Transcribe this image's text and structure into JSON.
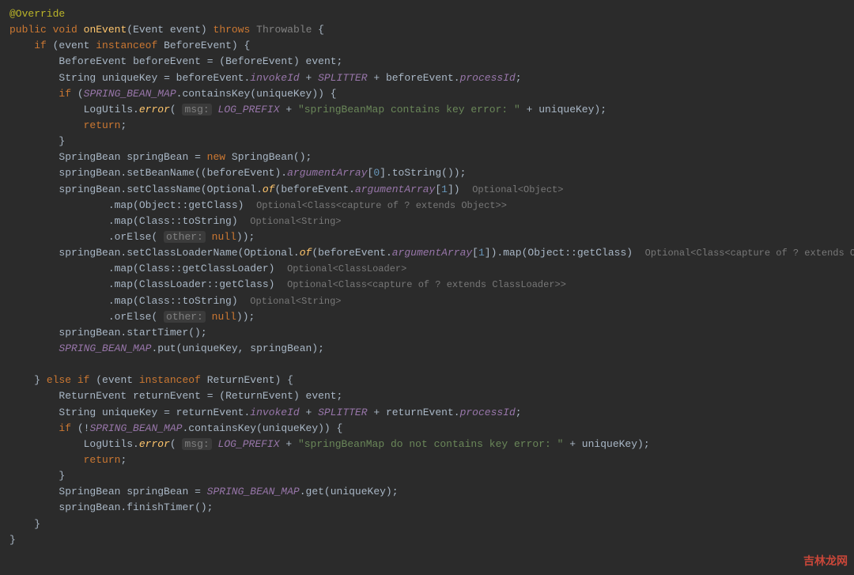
{
  "watermark": "吉林龙网",
  "ann_override": "@Override",
  "kw_public": "public",
  "kw_void": "void",
  "method_onEvent": "onEvent",
  "type_Event": "Event",
  "param_event": "event",
  "kw_throws": "throws",
  "type_Throwable": "Throwable",
  "kw_if": "if",
  "kw_else": "else",
  "kw_instanceof": "instanceof",
  "type_BeforeEvent": "BeforeEvent",
  "var_beforeEvent": "beforeEvent",
  "type_String": "String",
  "var_uniqueKey": "uniqueKey",
  "field_invokeId": "invokeId",
  "const_SPLITTER": "SPLITTER",
  "field_processId": "processId",
  "const_SPRING_BEAN_MAP": "SPRING_BEAN_MAP",
  "method_containsKey": "containsKey",
  "type_LogUtils": "LogUtils",
  "method_error": "error",
  "hint_msg": "msg:",
  "const_LOG_PREFIX": "LOG_PREFIX",
  "str_contains_err": "\"springBeanMap contains key error: \"",
  "kw_return": "return",
  "type_SpringBean": "SpringBean",
  "var_springBean": "springBean",
  "kw_new": "new",
  "method_setBeanName": "setBeanName",
  "field_argumentArray": "argumentArray",
  "num_0": "0",
  "num_1": "1",
  "method_toString": "toString",
  "method_setClassName": "setClassName",
  "type_Optional": "Optional",
  "method_of": "of",
  "hint_opt_object": "Optional<Object>",
  "method_map": "map",
  "ref_Object_getClass": "Object::getClass",
  "hint_opt_class_obj": "Optional<Class<capture of ? extends Object>>",
  "ref_Class_toString": "Class::toString",
  "hint_opt_string": "Optional<String>",
  "method_orElse": "orElse",
  "hint_other": "other:",
  "kw_null": "null",
  "method_setClassLoaderName": "setClassLoaderName",
  "ref_Class_getClassLoader": "Class::getClassLoader",
  "hint_opt_classloader": "Optional<ClassLoader>",
  "ref_ClassLoader_getClass": "ClassLoader::getClass",
  "hint_opt_class_cl": "Optional<Class<capture of ? extends ClassLoader>>",
  "method_startTimer": "startTimer",
  "method_put": "put",
  "type_ReturnEvent": "ReturnEvent",
  "var_returnEvent": "returnEvent",
  "str_not_contains_err": "\"springBeanMap do not contains key error: \"",
  "method_get": "get",
  "method_finishTimer": "finishTimer"
}
